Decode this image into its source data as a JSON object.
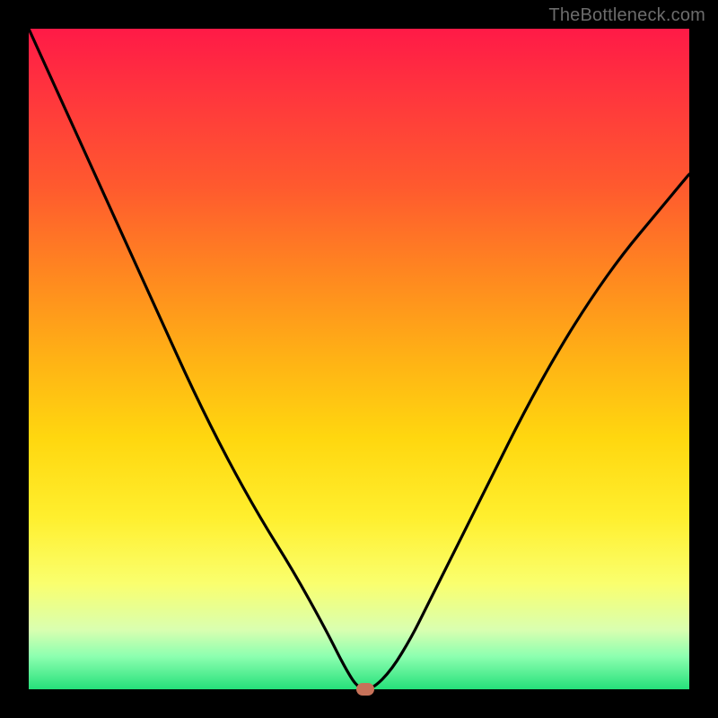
{
  "credit_text": "TheBottleneck.com",
  "chart_data": {
    "type": "line",
    "title": "",
    "xlabel": "",
    "ylabel": "",
    "xlim": [
      0,
      100
    ],
    "ylim": [
      0,
      100
    ],
    "series": [
      {
        "name": "bottleneck-curve",
        "x": [
          0,
          5,
          10,
          15,
          20,
          25,
          30,
          35,
          40,
          45,
          48,
          50,
          52,
          55,
          58,
          60,
          65,
          70,
          75,
          80,
          85,
          90,
          95,
          100
        ],
        "y": [
          100,
          89,
          78,
          67,
          56,
          45,
          35,
          26,
          18,
          9,
          3,
          0,
          0,
          3,
          8,
          12,
          22,
          32,
          42,
          51,
          59,
          66,
          72,
          78
        ]
      }
    ],
    "marker": {
      "x": 51,
      "y": 0
    },
    "gradient_stops": [
      {
        "pos": 0,
        "color": "#ff1a47"
      },
      {
        "pos": 50,
        "color": "#ffd70f"
      },
      {
        "pos": 100,
        "color": "#25e07a"
      }
    ]
  }
}
